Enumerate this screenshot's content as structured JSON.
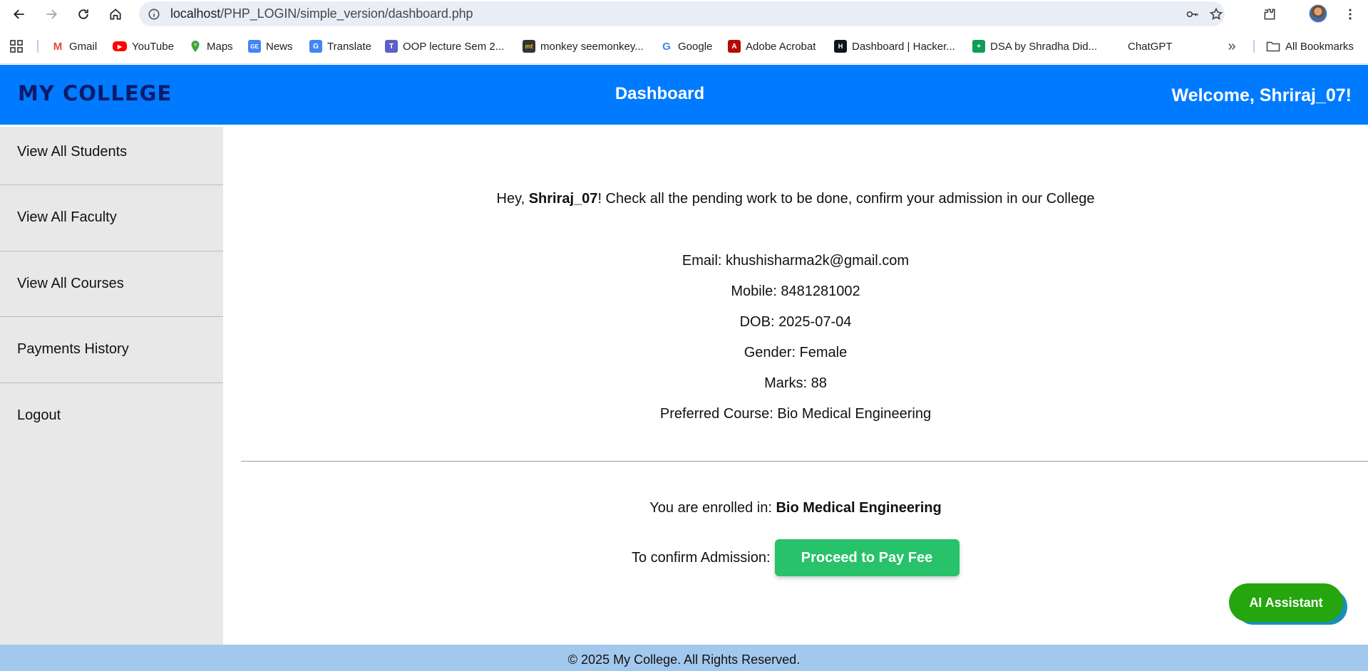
{
  "browser": {
    "url_host": "localhost",
    "url_path": "/PHP_LOGIN/simple_version/dashboard.php",
    "bookmarks": [
      {
        "label": "Gmail",
        "icon": "gmail-icon",
        "color": "#ea4335"
      },
      {
        "label": "YouTube",
        "icon": "youtube-icon",
        "color": "#ff0000"
      },
      {
        "label": "Maps",
        "icon": "maps-icon",
        "color": "#34a853"
      },
      {
        "label": "News",
        "icon": "news-icon",
        "color": "#4285f4"
      },
      {
        "label": "Translate",
        "icon": "translate-icon",
        "color": "#4285f4"
      },
      {
        "label": "OOP lecture Sem 2...",
        "icon": "teams-icon",
        "color": "#5b5fc7"
      },
      {
        "label": "monkey seemonkey...",
        "icon": "monkeytype-icon",
        "color": "#323437"
      },
      {
        "label": "Google",
        "icon": "google-icon",
        "color": "#4285f4"
      },
      {
        "label": "Adobe Acrobat",
        "icon": "acrobat-icon",
        "color": "#b30b00"
      },
      {
        "label": "Dashboard | Hacker...",
        "icon": "hackerrank-icon",
        "color": "#0e141e"
      },
      {
        "label": "DSA by Shradha Did...",
        "icon": "sheets-icon",
        "color": "#0f9d58"
      },
      {
        "label": "ChatGPT",
        "icon": "",
        "color": ""
      }
    ],
    "all_bookmarks_label": "All Bookmarks"
  },
  "header": {
    "brand": "MY COLLEGE",
    "title": "Dashboard",
    "welcome_prefix": "Welcome, ",
    "username": "Shriraj_07",
    "welcome_suffix": "!"
  },
  "sidebar": {
    "items": [
      {
        "label": "View All Students"
      },
      {
        "label": "View All Faculty"
      },
      {
        "label": "View All Courses"
      },
      {
        "label": "Payments History"
      },
      {
        "label": "Logout"
      }
    ]
  },
  "main": {
    "greeting_prefix": "Hey, ",
    "greeting_name": "Shriraj_07",
    "greeting_suffix": "! Check all the pending work to be done, confirm your admission in our College",
    "email": "Email: khushisharma2k@gmail.com",
    "mobile": "Mobile: 8481281002",
    "dob": "DOB: 2025-07-04",
    "gender": "Gender: Female",
    "marks": "Marks: 88",
    "preferred_course": "Preferred Course: Bio Medical Engineering",
    "enrolled_prefix": "You are enrolled in: ",
    "enrolled_course": "Bio Medical Engineering",
    "confirm_label": "To confirm Admission:",
    "pay_button": "Proceed to Pay Fee"
  },
  "ai_assistant_label": "AI Assistant",
  "footer": {
    "text": "© 2025 My College. All Rights Reserved."
  },
  "colors": {
    "header_bg": "#007bff",
    "brand_text": "#0b1a6b",
    "sidebar_bg": "#e8e8e8",
    "pay_button_bg": "#27c26a",
    "ai_button_bg": "#25a50e",
    "footer_bg": "#a3c8ee"
  }
}
